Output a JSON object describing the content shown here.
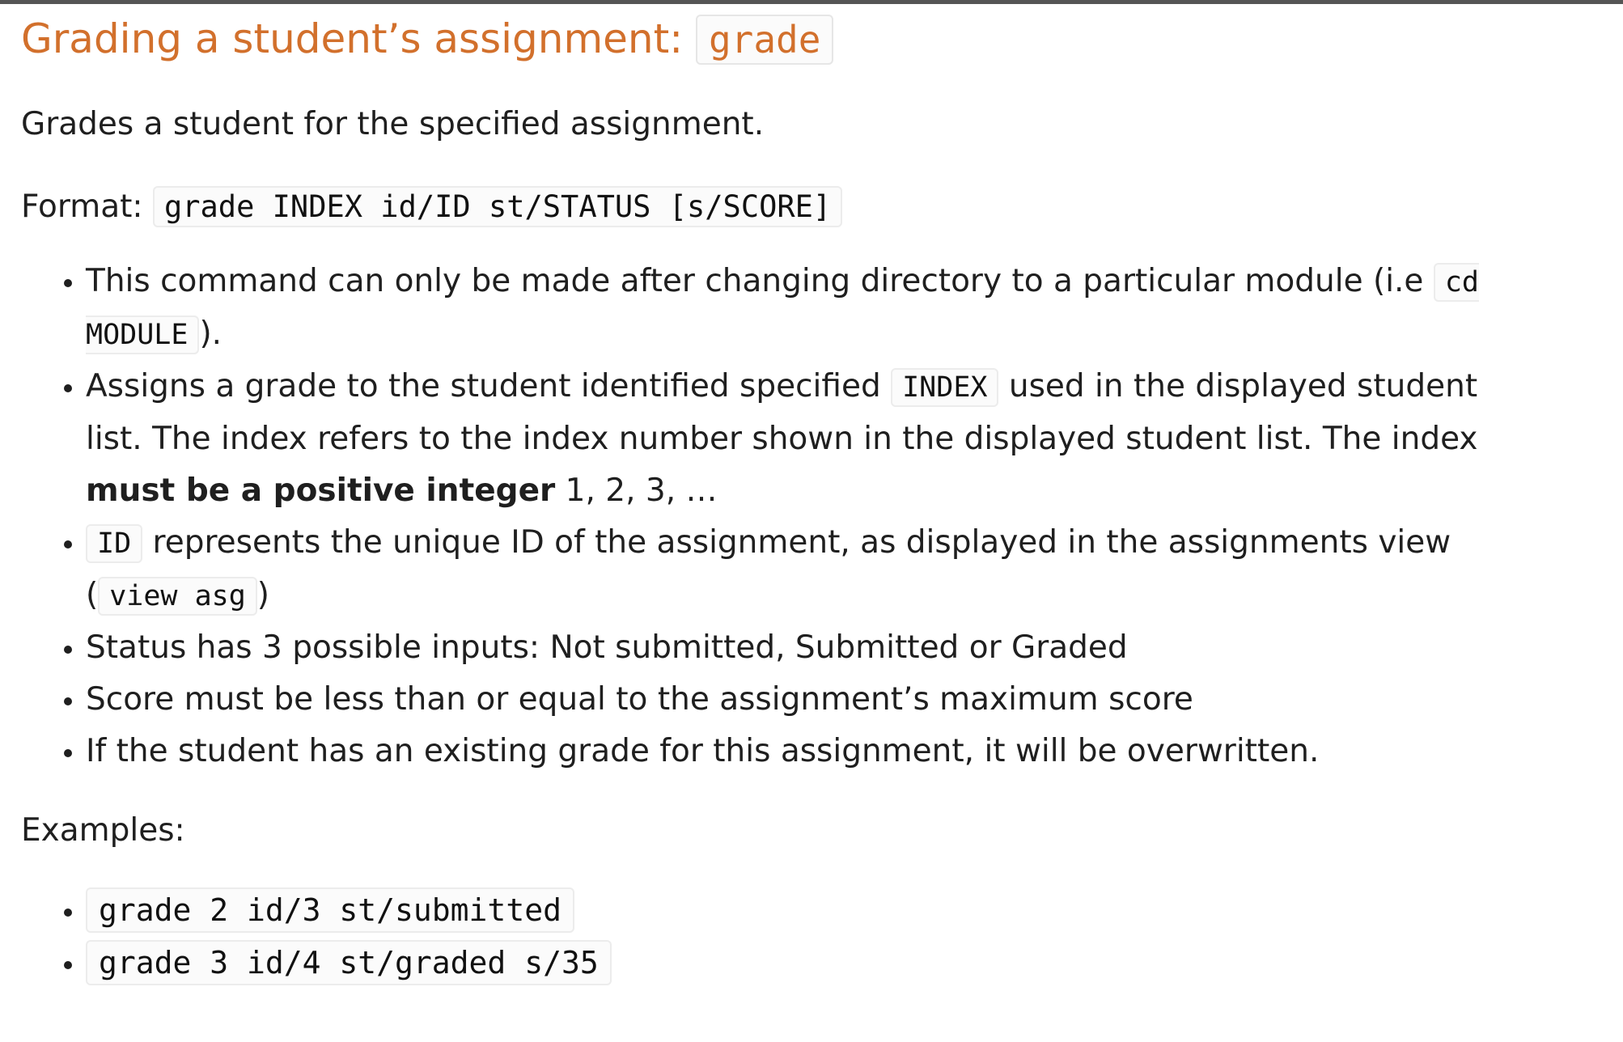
{
  "heading": {
    "text": "Grading a student’s assignment: ",
    "code": "grade"
  },
  "description": "Grades a student for the specified assignment.",
  "format": {
    "label": "Format: ",
    "code": "grade INDEX id/ID st/STATUS [s/SCORE]"
  },
  "notes": {
    "n1": {
      "text_before": "This command can only be made after changing directory to a particular module (i.e ",
      "code": "cd MODULE",
      "text_after": ")."
    },
    "n2": {
      "text_before": "Assigns a grade to the student identified specified ",
      "code": "INDEX",
      "text_middle": " used in the displayed student list. The index refers to the index number shown in the displayed student list. The index ",
      "bold": "must be a positive integer",
      "text_after": " 1, 2, 3, …"
    },
    "n3": {
      "code": "ID",
      "text_middle": " represents the unique ID of the assignment, as displayed in the assignments view (",
      "code2": "view asg",
      "text_after": ")"
    },
    "n4": {
      "text": "Status has 3 possible inputs: Not submitted, Submitted or Graded"
    },
    "n5": {
      "text": "Score must be less than or equal to the assignment’s maximum score"
    },
    "n6": {
      "text": "If the student has an existing grade for this assignment, it will be overwritten."
    }
  },
  "examples_label": "Examples:",
  "examples": [
    "grade 2 id/3 st/submitted",
    "grade 3 id/4 st/graded s/35"
  ]
}
